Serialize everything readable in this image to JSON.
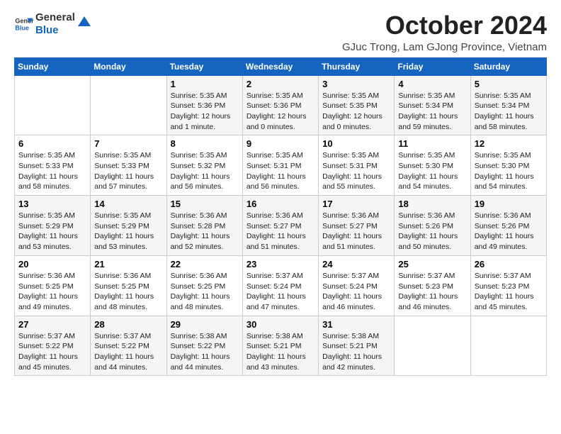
{
  "header": {
    "logo_general": "General",
    "logo_blue": "Blue",
    "month_title": "October 2024",
    "location": "GJuc Trong, Lam GJong Province, Vietnam"
  },
  "weekdays": [
    "Sunday",
    "Monday",
    "Tuesday",
    "Wednesday",
    "Thursday",
    "Friday",
    "Saturday"
  ],
  "weeks": [
    [
      {
        "day": "",
        "info": ""
      },
      {
        "day": "",
        "info": ""
      },
      {
        "day": "1",
        "info": "Sunrise: 5:35 AM\nSunset: 5:36 PM\nDaylight: 12 hours\nand 1 minute."
      },
      {
        "day": "2",
        "info": "Sunrise: 5:35 AM\nSunset: 5:36 PM\nDaylight: 12 hours\nand 0 minutes."
      },
      {
        "day": "3",
        "info": "Sunrise: 5:35 AM\nSunset: 5:35 PM\nDaylight: 12 hours\nand 0 minutes."
      },
      {
        "day": "4",
        "info": "Sunrise: 5:35 AM\nSunset: 5:34 PM\nDaylight: 11 hours\nand 59 minutes."
      },
      {
        "day": "5",
        "info": "Sunrise: 5:35 AM\nSunset: 5:34 PM\nDaylight: 11 hours\nand 58 minutes."
      }
    ],
    [
      {
        "day": "6",
        "info": "Sunrise: 5:35 AM\nSunset: 5:33 PM\nDaylight: 11 hours\nand 58 minutes."
      },
      {
        "day": "7",
        "info": "Sunrise: 5:35 AM\nSunset: 5:33 PM\nDaylight: 11 hours\nand 57 minutes."
      },
      {
        "day": "8",
        "info": "Sunrise: 5:35 AM\nSunset: 5:32 PM\nDaylight: 11 hours\nand 56 minutes."
      },
      {
        "day": "9",
        "info": "Sunrise: 5:35 AM\nSunset: 5:31 PM\nDaylight: 11 hours\nand 56 minutes."
      },
      {
        "day": "10",
        "info": "Sunrise: 5:35 AM\nSunset: 5:31 PM\nDaylight: 11 hours\nand 55 minutes."
      },
      {
        "day": "11",
        "info": "Sunrise: 5:35 AM\nSunset: 5:30 PM\nDaylight: 11 hours\nand 54 minutes."
      },
      {
        "day": "12",
        "info": "Sunrise: 5:35 AM\nSunset: 5:30 PM\nDaylight: 11 hours\nand 54 minutes."
      }
    ],
    [
      {
        "day": "13",
        "info": "Sunrise: 5:35 AM\nSunset: 5:29 PM\nDaylight: 11 hours\nand 53 minutes."
      },
      {
        "day": "14",
        "info": "Sunrise: 5:35 AM\nSunset: 5:29 PM\nDaylight: 11 hours\nand 53 minutes."
      },
      {
        "day": "15",
        "info": "Sunrise: 5:36 AM\nSunset: 5:28 PM\nDaylight: 11 hours\nand 52 minutes."
      },
      {
        "day": "16",
        "info": "Sunrise: 5:36 AM\nSunset: 5:27 PM\nDaylight: 11 hours\nand 51 minutes."
      },
      {
        "day": "17",
        "info": "Sunrise: 5:36 AM\nSunset: 5:27 PM\nDaylight: 11 hours\nand 51 minutes."
      },
      {
        "day": "18",
        "info": "Sunrise: 5:36 AM\nSunset: 5:26 PM\nDaylight: 11 hours\nand 50 minutes."
      },
      {
        "day": "19",
        "info": "Sunrise: 5:36 AM\nSunset: 5:26 PM\nDaylight: 11 hours\nand 49 minutes."
      }
    ],
    [
      {
        "day": "20",
        "info": "Sunrise: 5:36 AM\nSunset: 5:25 PM\nDaylight: 11 hours\nand 49 minutes."
      },
      {
        "day": "21",
        "info": "Sunrise: 5:36 AM\nSunset: 5:25 PM\nDaylight: 11 hours\nand 48 minutes."
      },
      {
        "day": "22",
        "info": "Sunrise: 5:36 AM\nSunset: 5:25 PM\nDaylight: 11 hours\nand 48 minutes."
      },
      {
        "day": "23",
        "info": "Sunrise: 5:37 AM\nSunset: 5:24 PM\nDaylight: 11 hours\nand 47 minutes."
      },
      {
        "day": "24",
        "info": "Sunrise: 5:37 AM\nSunset: 5:24 PM\nDaylight: 11 hours\nand 46 minutes."
      },
      {
        "day": "25",
        "info": "Sunrise: 5:37 AM\nSunset: 5:23 PM\nDaylight: 11 hours\nand 46 minutes."
      },
      {
        "day": "26",
        "info": "Sunrise: 5:37 AM\nSunset: 5:23 PM\nDaylight: 11 hours\nand 45 minutes."
      }
    ],
    [
      {
        "day": "27",
        "info": "Sunrise: 5:37 AM\nSunset: 5:22 PM\nDaylight: 11 hours\nand 45 minutes."
      },
      {
        "day": "28",
        "info": "Sunrise: 5:37 AM\nSunset: 5:22 PM\nDaylight: 11 hours\nand 44 minutes."
      },
      {
        "day": "29",
        "info": "Sunrise: 5:38 AM\nSunset: 5:22 PM\nDaylight: 11 hours\nand 44 minutes."
      },
      {
        "day": "30",
        "info": "Sunrise: 5:38 AM\nSunset: 5:21 PM\nDaylight: 11 hours\nand 43 minutes."
      },
      {
        "day": "31",
        "info": "Sunrise: 5:38 AM\nSunset: 5:21 PM\nDaylight: 11 hours\nand 42 minutes."
      },
      {
        "day": "",
        "info": ""
      },
      {
        "day": "",
        "info": ""
      }
    ]
  ]
}
